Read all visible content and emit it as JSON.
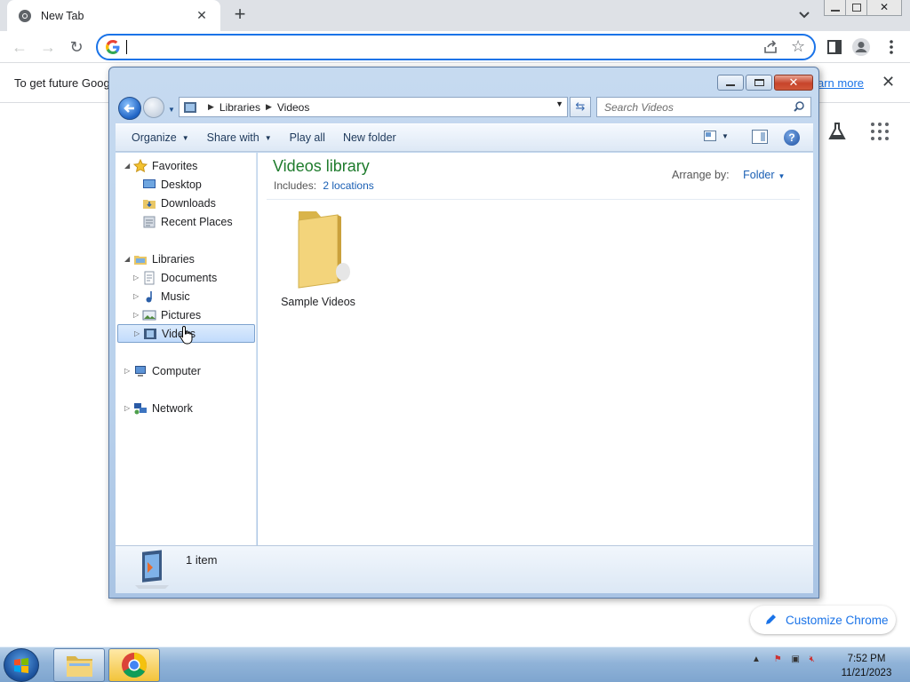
{
  "browser": {
    "tab_title": "New Tab",
    "tab_close": "✕",
    "new_tab": "+",
    "infobar_message": "To get future Goog",
    "infobar_link": "arn more",
    "infobar_close": "✕",
    "customize_label": "Customize Chrome"
  },
  "explorer": {
    "breadcrumb": [
      "Libraries",
      "Videos"
    ],
    "search_placeholder": "Search Videos",
    "commands": [
      "Organize",
      "Share with",
      "Play all",
      "New folder"
    ],
    "nav": {
      "favorites": "Favorites",
      "desktop": "Desktop",
      "downloads": "Downloads",
      "recent_places": "Recent Places",
      "libraries": "Libraries",
      "documents": "Documents",
      "music": "Music",
      "pictures": "Pictures",
      "videos": "Videos",
      "computer": "Computer",
      "network": "Network"
    },
    "library_title": "Videos library",
    "includes_label": "Includes:",
    "includes_link": "2 locations",
    "arrange_label": "Arrange by:",
    "arrange_value": "Folder",
    "items": [
      {
        "name": "Sample Videos"
      }
    ],
    "status_count": "1 item"
  },
  "taskbar": {
    "time": "7:52 PM",
    "date": "11/21/2023"
  }
}
